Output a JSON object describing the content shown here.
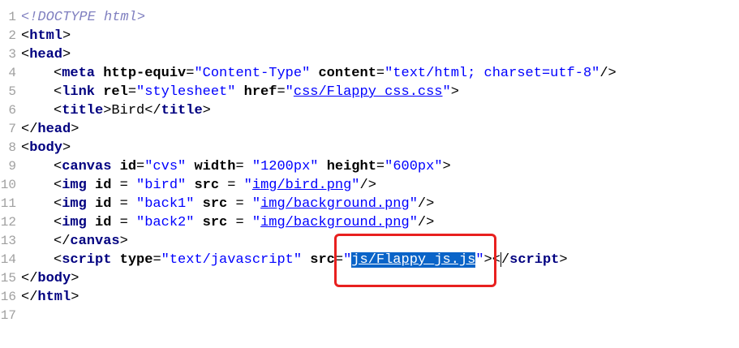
{
  "line_numbers": [
    "1",
    "2",
    "3",
    "4",
    "5",
    "6",
    "7",
    "8",
    "9",
    "10",
    "11",
    "12",
    "13",
    "14",
    "15",
    "16",
    "17"
  ],
  "code": {
    "l1": "<!DOCTYPE html>",
    "l2_tag": "html",
    "l3_tag": "head",
    "l4_tag": "meta",
    "l4_attr1": "http-equiv",
    "l4_val1": "\"Content-Type\"",
    "l4_attr2": "content",
    "l4_val2": "\"text/html; charset=utf-8\"",
    "l5_tag": "link",
    "l5_attr1": "rel",
    "l5_val1": "\"stylesheet\"",
    "l5_attr2": "href",
    "l5_url": "css/Flappy_css.css",
    "l6_tag": "title",
    "l6_text": "Bird",
    "l7_tag": "head",
    "l8_tag": "body",
    "l9_tag": "canvas",
    "l9_attr1": "id",
    "l9_val1": "\"cvs\"",
    "l9_attr2": "width",
    "l9_val2": "\"1200px\"",
    "l9_attr3": "height",
    "l9_val3": "\"600px\"",
    "l10_tag": "img",
    "l10_attr1": "id",
    "l10_val1": "\"bird\"",
    "l10_attr2": "src",
    "l10_url": "img/bird.png",
    "l11_tag": "img",
    "l11_attr1": "id",
    "l11_val1": "\"back1\"",
    "l11_attr2": "src",
    "l11_url": "img/background.png",
    "l12_tag": "img",
    "l12_attr1": "id",
    "l12_val1": "\"back2\"",
    "l12_attr2": "src",
    "l12_url": "img/background.png",
    "l13_tag": "canvas",
    "l14_tag": "script",
    "l14_attr1": "type",
    "l14_val1": "\"text/javascript\"",
    "l14_attr2": "src",
    "l14_selected": "js/Flappy_js.js",
    "l15_tag": "body",
    "l16_tag": "html"
  },
  "colors": {
    "tag": "#000080",
    "string": "#0000ff",
    "selection": "#0a64c8",
    "annotation_box": "#e8201f"
  }
}
